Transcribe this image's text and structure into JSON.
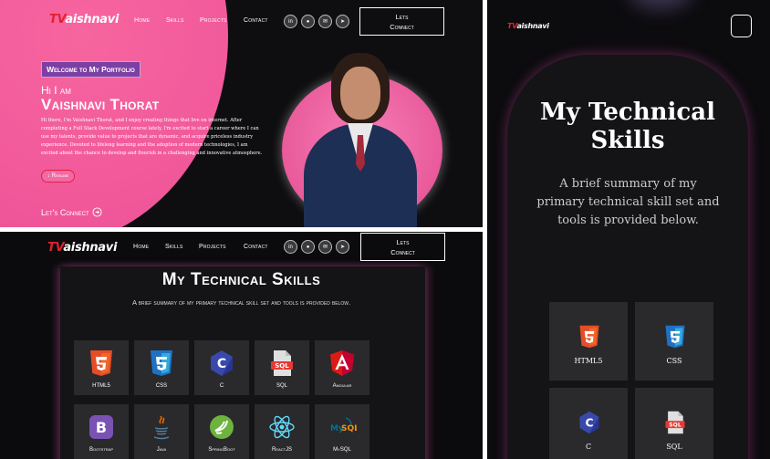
{
  "logo": {
    "mark": "TV",
    "rest": "aishnavi"
  },
  "nav": {
    "home": "Home",
    "skills": "Skills",
    "projects": "Projects",
    "contact": "Contact",
    "cta_line1": "Lets",
    "cta_line2": "Connect"
  },
  "socials": [
    "linkedin-icon",
    "github-icon",
    "mail-icon",
    "telegram-icon"
  ],
  "hero": {
    "badge": "Welcome to My Portfolio",
    "greeting": "Hi I am",
    "name": "Vaishnavi Thorat",
    "bio": "Hi there, I'm Vaishnavi Thorat, and I enjoy creating things that live on internet. After completing a Full Stack Development course lately, I'm excited to start a career where I can use my talents, provide value to projects that are dynamic, and acquire priceless industry experience. Devoted to lifelong learning and the adoption of modern technologies, I am excited about the chance to develop and flourish in a challenging and innovative atmosphere.",
    "resume": "↓ Resume",
    "connect": "Let's Connect"
  },
  "skills": {
    "title": "My Technical Skills",
    "subtitle": "A brief summary of my primary technical skill set and tools is provided below.",
    "items": [
      {
        "label": "HTML5",
        "icon": "html5-icon",
        "color": "#e44d26"
      },
      {
        "label": "CSS",
        "icon": "css3-icon",
        "color": "#1f72c3"
      },
      {
        "label": "C",
        "icon": "c-icon",
        "color": "#3949ab"
      },
      {
        "label": "SQL",
        "icon": "sql-icon",
        "color": "#e53935"
      },
      {
        "label": "Angular",
        "icon": "angular-icon",
        "color": "#dd1b16"
      },
      {
        "label": "Bootstrap",
        "icon": "bootstrap-icon",
        "color": "#7952b3"
      },
      {
        "label": "Java",
        "icon": "java-icon",
        "color": "#e76f00"
      },
      {
        "label": "SpringBoot",
        "icon": "springboot-icon",
        "color": "#6db33f"
      },
      {
        "label": "ReactJS",
        "icon": "react-icon",
        "color": "#61dafb"
      },
      {
        "label": "MySQL",
        "icon": "mysql-icon",
        "color": "#00758f"
      }
    ]
  },
  "mobile": {
    "title_line1": "My Technical",
    "title_line2": "Skills",
    "subtitle": "A brief summary of my primary technical skill set and tools is provided below."
  }
}
